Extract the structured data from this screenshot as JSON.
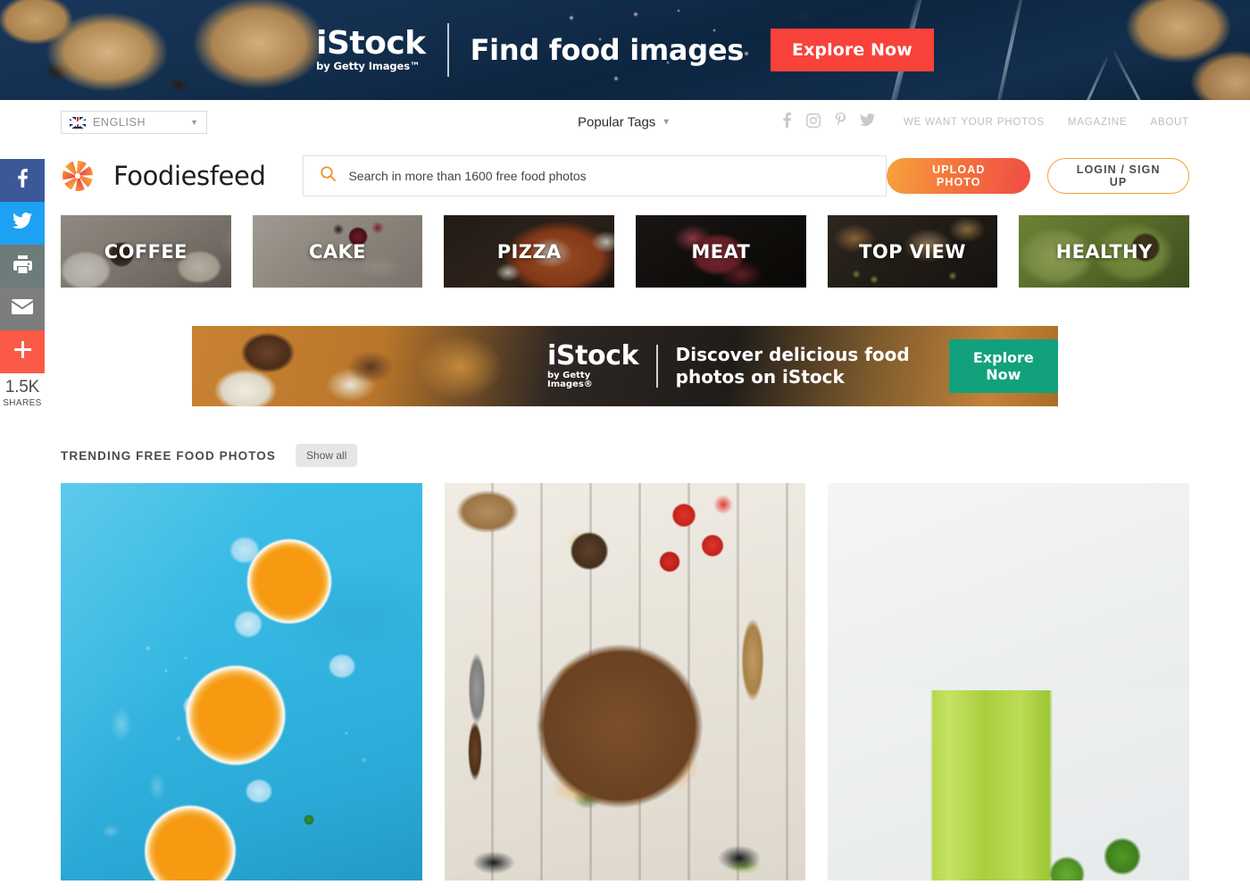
{
  "top_banner": {
    "logo_main": "iStock",
    "logo_sub": "by Getty Images™",
    "headline": "Find food images",
    "cta_label": "Explore Now",
    "cta_color": "#f9423a"
  },
  "share_rail": {
    "buttons": [
      {
        "name": "facebook",
        "icon": "facebook-icon",
        "color": "#3b5998"
      },
      {
        "name": "twitter",
        "icon": "twitter-icon",
        "color": "#1da1f2"
      },
      {
        "name": "print",
        "icon": "printer-icon",
        "color": "#6d7b7b"
      },
      {
        "name": "email",
        "icon": "envelope-icon",
        "color": "#7d7d7d"
      },
      {
        "name": "more",
        "icon": "plus-icon",
        "color": "#fb5a47"
      }
    ],
    "count": "1.5K",
    "count_label": "SHARES"
  },
  "util_bar": {
    "language": "ENGLISH",
    "language_flag": "uk-flag-icon",
    "popular_tags": "Popular Tags",
    "social": [
      {
        "name": "facebook",
        "icon": "facebook-icon"
      },
      {
        "name": "instagram",
        "icon": "instagram-icon"
      },
      {
        "name": "pinterest",
        "icon": "pinterest-icon"
      },
      {
        "name": "twitter",
        "icon": "twitter-icon"
      }
    ],
    "links": [
      "WE WANT YOUR PHOTOS",
      "MAGAZINE",
      "ABOUT"
    ]
  },
  "header": {
    "brand": "Foodiesfeed",
    "brand_icon": "aperture-logo-icon",
    "search_placeholder": "Search in more than 1600 free food photos",
    "search_value": "",
    "search_icon": "search-icon",
    "upload_label": "UPLOAD PHOTO",
    "login_label": "LOGIN / SIGN UP",
    "accent_orange": "#f3a03c",
    "accent_red": "#ef4d44"
  },
  "categories": [
    {
      "label": "COFFEE",
      "img_class": "ci-coffee"
    },
    {
      "label": "CAKE",
      "img_class": "ci-cake"
    },
    {
      "label": "PIZZA",
      "img_class": "ci-pizza"
    },
    {
      "label": "MEAT",
      "img_class": "ci-meat"
    },
    {
      "label": "TOP VIEW",
      "img_class": "ci-topview"
    },
    {
      "label": "HEALTHY",
      "img_class": "ci-healthy"
    }
  ],
  "banner2": {
    "logo_main": "iStock",
    "logo_sub": "by Getty Images®",
    "headline": "Discover delicious food photos on iStock",
    "cta_label": "Explore Now",
    "cta_color": "#12a17d"
  },
  "trending": {
    "title": "TRENDING FREE FOOD PHOTOS",
    "show_all_label": "Show all",
    "photos": [
      {
        "alt": "orange-slices-on-blue-background",
        "img_class": "pc-oranges"
      },
      {
        "alt": "burger-flatlay-on-white-wood",
        "img_class": "pc-burger"
      },
      {
        "alt": "green-lime-juice-splash",
        "img_class": "pc-juice"
      }
    ]
  }
}
